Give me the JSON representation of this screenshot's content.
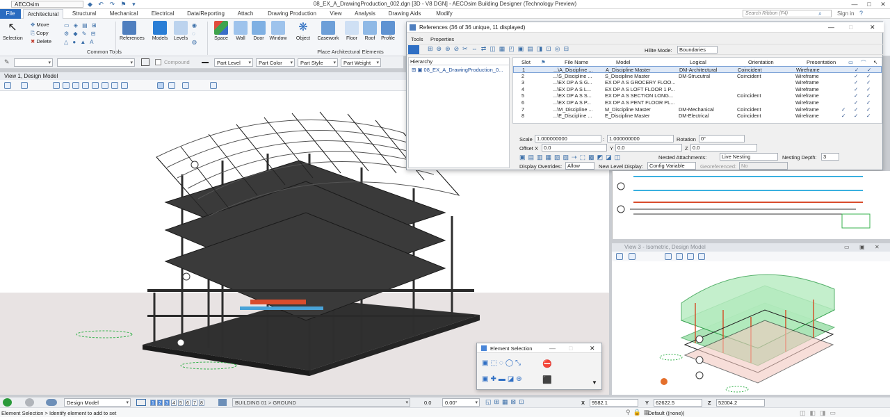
{
  "titlebar": {
    "workspace": "AECOsim",
    "title": "08_EX_A_DrawingProduction_002.dgn [3D - V8 DGN] - AECOsim Building Designer (Technology Preview)"
  },
  "tabs": [
    "File",
    "Architectural",
    "Structural",
    "Mechanical",
    "Electrical",
    "Data/Reporting",
    "Attach",
    "Drawing Production",
    "View",
    "Analysis",
    "Drawing Aids",
    "Modify"
  ],
  "search": {
    "placeholder": "Search Ribbon (F4)"
  },
  "signin": "Sign in",
  "ribbon": {
    "selection": "Selection",
    "move": "Move",
    "copy": "Copy",
    "delete": "Delete",
    "common_tools": "Common Tools",
    "references": "References",
    "models": "Models",
    "levels": "Levels",
    "space": "Space",
    "wall": "Wall",
    "door": "Door",
    "window": "Window",
    "object": "Object",
    "casework": "Casework",
    "floor": "Floor",
    "roof": "Roof",
    "profile": "Profile",
    "place_arch": "Place Architectural Elements"
  },
  "attr": {
    "compound": "Compound",
    "part_level": "Part Level",
    "part_color": "Part Color",
    "part_style": "Part Style",
    "part_weight": "Part Weight"
  },
  "view1": {
    "title": "View 1, Design Model"
  },
  "references": {
    "title": "References (36 of 36 unique, 11 displayed)",
    "menu": [
      "Tools",
      "Properties"
    ],
    "hilite_label": "Hilite Mode:",
    "hilite_value": "Boundaries",
    "hierarchy_label": "Hierarchy",
    "hierarchy_item": "08_EX_A_DrawingProduction_0...",
    "columns": [
      "Slot",
      "File Name",
      "Model",
      "Logical",
      "Orientation",
      "Presentation"
    ],
    "rows": [
      {
        "slot": "1",
        "file": "...\\A_Discipline ...",
        "model": "A_Discipline Master",
        "logical": "DM-Architectural",
        "orient": "Coincident",
        "pres": "Wireframe",
        "c1": "",
        "c2": "✓",
        "c3": "✓"
      },
      {
        "slot": "2",
        "file": "...\\S_Discipline ...",
        "model": "S_Discipline Master",
        "logical": "DM-Strucutral",
        "orient": "Coincident",
        "pres": "Wireframe",
        "c1": "",
        "c2": "✓",
        "c3": "✓"
      },
      {
        "slot": "3",
        "file": "...\\EX DP A S G...",
        "model": "EX DP A S GROCERY FLOO...",
        "logical": "",
        "orient": "",
        "pres": "Wireframe",
        "c1": "",
        "c2": "✓",
        "c3": "✓"
      },
      {
        "slot": "4",
        "file": "...\\EX DP A S L...",
        "model": "EX DP A S LOFT FLOOR 1 P...",
        "logical": "",
        "orient": "",
        "pres": "Wireframe",
        "c1": "",
        "c2": "✓",
        "c3": "✓"
      },
      {
        "slot": "5",
        "file": "...\\EX DP A S S...",
        "model": "EX DP A S SECTION LONG...",
        "logical": "",
        "orient": "Coincident",
        "pres": "Wireframe",
        "c1": "",
        "c2": "✓",
        "c3": "✓"
      },
      {
        "slot": "6",
        "file": "...\\EX DP A S P...",
        "model": "EX DP A S PENT FLOOR PL...",
        "logical": "",
        "orient": "",
        "pres": "Wireframe",
        "c1": "",
        "c2": "✓",
        "c3": "✓"
      },
      {
        "slot": "7",
        "file": "...\\M_Discipline ...",
        "model": "M_Discipline Master",
        "logical": "DM-Mechanical",
        "orient": "Coincident",
        "pres": "Wireframe",
        "c1": "✓",
        "c2": "✓",
        "c3": "✓"
      },
      {
        "slot": "8",
        "file": "...\\E_Discipline ...",
        "model": "E_Discipline Master",
        "logical": "DM-Electrical",
        "orient": "Coincident",
        "pres": "Wireframe",
        "c1": "✓",
        "c2": "✓",
        "c3": "✓"
      }
    ],
    "scale_label": "Scale",
    "scale_a": "1.000000000",
    "scale_b": "1.000000000",
    "rotation_label": "Rotation",
    "rotation": "0°",
    "offset_x_label": "Offset X",
    "offset_x": "0.0",
    "y_label": "Y",
    "y": "0.0",
    "z_label": "Z",
    "z": "0.0",
    "nested_label": "Nested Attachments:",
    "nested_value": "Live Nesting",
    "depth_label": "Nesting Depth:",
    "depth": "3",
    "overrides_label": "Display Overrides:",
    "overrides_value": "Allow",
    "newlevel_label": "New Level Display:",
    "newlevel_value": "Config Variable",
    "geo_label": "Georeferenced:",
    "geo_value": "No"
  },
  "view3": {
    "title": "View 3 - Isometric, Design Model"
  },
  "element_selection": {
    "title": "Element Selection"
  },
  "status": {
    "model": "Design Model",
    "views": [
      "1",
      "2",
      "3",
      "4",
      "5",
      "6",
      "7",
      "8"
    ],
    "level": "BUILDING 01 > GROUND",
    "v1": "0.0",
    "v2": "0.00°",
    "x_label": "X",
    "x": "9582.1",
    "y_label": "Y",
    "y": "62622.5",
    "z_label": "Z",
    "z": "52004.2",
    "prompt": "Element Selection > Identify element to add to set",
    "default": "Default ((none))"
  },
  "colors": {
    "accent": "#2a6cc0",
    "tab_active": "#f4f6f9",
    "selection": "#dfe9f7"
  }
}
